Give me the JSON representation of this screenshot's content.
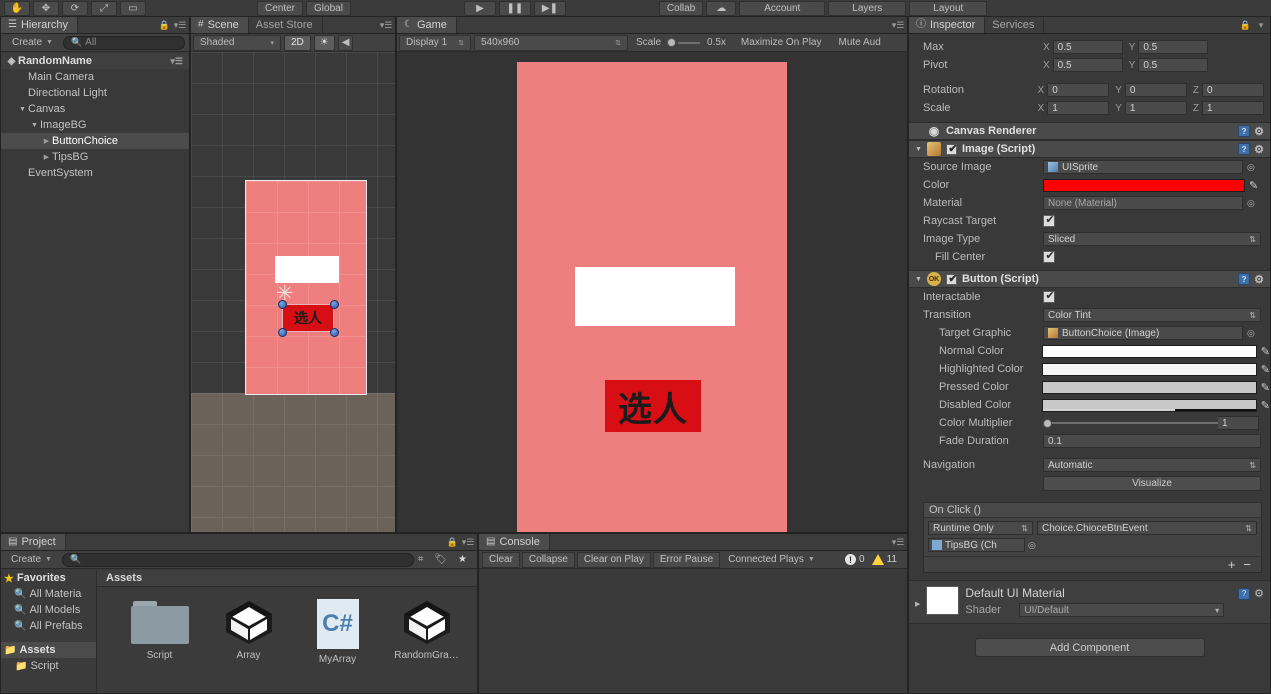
{
  "topbar": {
    "transform_tools": [
      "hand-tool",
      "move-tool",
      "rotate-tool",
      "scale-tool",
      "rect-tool"
    ],
    "pivot_mode": "Center",
    "pivot_rotation": "Global",
    "playback": [
      "play-button",
      "pause-button",
      "step-button"
    ],
    "collab": "Collab",
    "cloud": "cloud-button",
    "account": "Account",
    "layers": "Layers",
    "layout": "Layout"
  },
  "hierarchy": {
    "tab": "Hierarchy",
    "create_label": "Create",
    "search_placeholder": "All",
    "scene_name": "RandomName",
    "items": [
      {
        "label": "Main Camera",
        "depth": 1,
        "arrow": "",
        "selected": false
      },
      {
        "label": "Directional Light",
        "depth": 1,
        "arrow": "",
        "selected": false
      },
      {
        "label": "Canvas",
        "depth": 1,
        "arrow": "down",
        "selected": false
      },
      {
        "label": "ImageBG",
        "depth": 2,
        "arrow": "down",
        "selected": false
      },
      {
        "label": "ButtonChoice",
        "depth": 3,
        "arrow": "right",
        "selected": true
      },
      {
        "label": "TipsBG",
        "depth": 3,
        "arrow": "right",
        "selected": false
      },
      {
        "label": "EventSystem",
        "depth": 1,
        "arrow": "",
        "selected": false
      }
    ]
  },
  "scene": {
    "tabs": [
      {
        "label": "Scene",
        "icon": "scene-grid-icon",
        "active": true
      },
      {
        "label": "Asset Store",
        "icon": "",
        "active": false
      }
    ],
    "draw_mode": "Shaded",
    "mode_2d": "2D",
    "lighting_icon": "sun-icon",
    "audio_icon": "speaker-icon",
    "button_text": "选人"
  },
  "game": {
    "tab": "Game",
    "display": "Display 1",
    "resolution": "540x960",
    "scale_label": "Scale",
    "scale_value": "0.5x",
    "maximize_on_play": "Maximize On Play",
    "mute_audio": "Mute Aud",
    "stage_bg": "#ef7f7f",
    "panel_color": "#ffffff",
    "button_color": "#d70f15",
    "button_text": "选人"
  },
  "project": {
    "tab": "Project",
    "create_label": "Create",
    "search_placeholder": "",
    "breadcrumb": "Assets",
    "favorites_label": "Favorites",
    "favorites": [
      "All Materia",
      "All Models",
      "All Prefabs"
    ],
    "tree": [
      {
        "label": "Assets",
        "selected": true,
        "bold": true
      },
      {
        "label": "Script",
        "selected": false,
        "bold": false
      }
    ],
    "assets": [
      {
        "label": "Script",
        "icon": "folder-icon"
      },
      {
        "label": "Array",
        "icon": "unity-prefab-icon"
      },
      {
        "label": "MyArray",
        "icon": "csharp-script-icon"
      },
      {
        "label": "RandomGra…",
        "icon": "unity-prefab-icon"
      }
    ]
  },
  "console": {
    "tab": "Console",
    "buttons": [
      "Clear",
      "Collapse",
      "Clear on Play",
      "Error Pause"
    ],
    "connected_player": "Connected Plays",
    "error_count": "0",
    "warning_count": "11"
  },
  "inspector": {
    "tabs": [
      {
        "label": "Inspector",
        "active": true
      },
      {
        "label": "Services",
        "active": false
      }
    ],
    "rect_transform": {
      "rows": [
        {
          "label": "Max",
          "x": "0.5",
          "y": "0.5",
          "z": null
        },
        {
          "label": "Pivot",
          "x": "0.5",
          "y": "0.5",
          "z": null
        },
        {
          "label": "Rotation",
          "x": "0",
          "y": "0",
          "z": "0"
        },
        {
          "label": "Scale",
          "x": "1",
          "y": "1",
          "z": "1"
        }
      ]
    },
    "canvas_renderer": {
      "title": "Canvas Renderer",
      "icon": "eye-icon"
    },
    "image_script": {
      "title": "Image (Script)",
      "enabled": true,
      "source_image": "UISprite",
      "color_label": "Color",
      "color_value": "#ff0000",
      "material": "None (Material)",
      "raycast_target": true,
      "image_type": "Sliced",
      "fill_center": true,
      "labels": {
        "source_image": "Source Image",
        "material": "Material",
        "raycast_target": "Raycast Target",
        "image_type": "Image Type",
        "fill_center": "Fill Center"
      }
    },
    "button_script": {
      "title": "Button (Script)",
      "enabled": true,
      "interactable_label": "Interactable",
      "interactable": true,
      "transition_label": "Transition",
      "transition": "Color Tint",
      "target_graphic_label": "Target Graphic",
      "target_graphic": "ButtonChoice (Image)",
      "colors": [
        {
          "label": "Normal Color",
          "value": "#ffffff"
        },
        {
          "label": "Highlighted Color",
          "value": "#f5f5f5"
        },
        {
          "label": "Pressed Color",
          "value": "#c8c8c8"
        },
        {
          "label": "Disabled Color",
          "value": "#c8c8c8"
        }
      ],
      "color_multiplier_label": "Color Multiplier",
      "color_multiplier": "1",
      "fade_duration_label": "Fade Duration",
      "fade_duration": "0.1",
      "navigation_label": "Navigation",
      "navigation": "Automatic",
      "visualize_label": "Visualize"
    },
    "onclick": {
      "title": "On Click ()",
      "runtime_mode": "Runtime Only",
      "function": "Choice.ChioceBtnEvent",
      "object": "TipsBG (Ch",
      "add_label": "+",
      "remove_label": "−"
    },
    "material": {
      "title": "Default UI Material",
      "shader_label": "Shader",
      "shader": "UI/Default"
    },
    "add_component": "Add Component"
  }
}
